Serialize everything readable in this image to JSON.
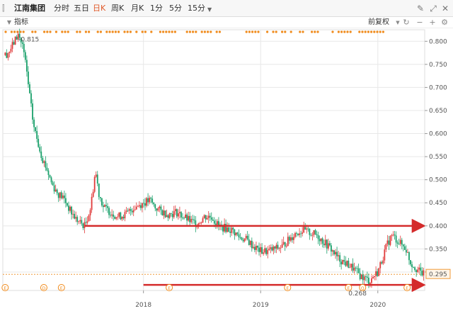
{
  "toolbar": {
    "stock_name": "江南集团",
    "tabs": [
      "分时",
      "五日",
      "日K",
      "周K",
      "月K",
      "1分",
      "5分",
      "15分"
    ],
    "active_tab": "日K",
    "dropdown_caret": "▼",
    "icons": [
      "pencil-icon",
      "fullscreen-icon",
      "close-icon"
    ]
  },
  "subbar": {
    "indicator_label": "指标",
    "adjust_label": "前复权",
    "icons": [
      "refresh-icon",
      "zoom-out-icon",
      "zoom-in-icon",
      "settings-icon"
    ]
  },
  "chart_data": {
    "type": "candlestick",
    "y_ticks": [
      "0.800",
      "0.750",
      "0.700",
      "0.650",
      "0.600",
      "0.550",
      "0.500",
      "0.450",
      "0.400",
      "0.350",
      "0.300"
    ],
    "ylim": [
      0.26,
      0.825
    ],
    "x_ticks": [
      "2018",
      "2019",
      "2020"
    ],
    "x_tick_positions": [
      2018.0,
      2019.0,
      2020.0
    ],
    "xlim": [
      2016.8,
      2020.4
    ],
    "current_price": "0.295",
    "high_annotation": "0.815",
    "low_annotation": "0.268",
    "trend": [
      [
        2016.82,
        0.77
      ],
      [
        2016.86,
        0.78
      ],
      [
        2016.9,
        0.8
      ],
      [
        2016.93,
        0.815
      ],
      [
        2016.97,
        0.79
      ],
      [
        2017.0,
        0.74
      ],
      [
        2017.03,
        0.68
      ],
      [
        2017.06,
        0.62
      ],
      [
        2017.1,
        0.58
      ],
      [
        2017.14,
        0.545
      ],
      [
        2017.18,
        0.52
      ],
      [
        2017.22,
        0.49
      ],
      [
        2017.27,
        0.47
      ],
      [
        2017.32,
        0.46
      ],
      [
        2017.38,
        0.43
      ],
      [
        2017.44,
        0.41
      ],
      [
        2017.5,
        0.4
      ],
      [
        2017.55,
        0.44
      ],
      [
        2017.59,
        0.52
      ],
      [
        2017.62,
        0.47
      ],
      [
        2017.66,
        0.44
      ],
      [
        2017.72,
        0.43
      ],
      [
        2017.78,
        0.42
      ],
      [
        2017.85,
        0.425
      ],
      [
        2017.92,
        0.44
      ],
      [
        2018.0,
        0.45
      ],
      [
        2018.06,
        0.455
      ],
      [
        2018.1,
        0.44
      ],
      [
        2018.16,
        0.43
      ],
      [
        2018.22,
        0.425
      ],
      [
        2018.28,
        0.43
      ],
      [
        2018.34,
        0.42
      ],
      [
        2018.4,
        0.41
      ],
      [
        2018.46,
        0.405
      ],
      [
        2018.52,
        0.42
      ],
      [
        2018.58,
        0.42
      ],
      [
        2018.64,
        0.4
      ],
      [
        2018.7,
        0.395
      ],
      [
        2018.76,
        0.39
      ],
      [
        2018.82,
        0.375
      ],
      [
        2018.88,
        0.37
      ],
      [
        2018.94,
        0.355
      ],
      [
        2019.0,
        0.345
      ],
      [
        2019.06,
        0.345
      ],
      [
        2019.12,
        0.35
      ],
      [
        2019.18,
        0.355
      ],
      [
        2019.24,
        0.37
      ],
      [
        2019.3,
        0.385
      ],
      [
        2019.36,
        0.39
      ],
      [
        2019.42,
        0.385
      ],
      [
        2019.48,
        0.38
      ],
      [
        2019.54,
        0.365
      ],
      [
        2019.6,
        0.35
      ],
      [
        2019.66,
        0.33
      ],
      [
        2019.72,
        0.32
      ],
      [
        2019.78,
        0.31
      ],
      [
        2019.82,
        0.3
      ],
      [
        2019.86,
        0.29
      ],
      [
        2019.9,
        0.285
      ],
      [
        2019.93,
        0.28
      ],
      [
        2019.96,
        0.29
      ],
      [
        2020.0,
        0.3
      ],
      [
        2020.04,
        0.33
      ],
      [
        2020.08,
        0.36
      ],
      [
        2020.12,
        0.38
      ],
      [
        2020.16,
        0.37
      ],
      [
        2020.2,
        0.36
      ],
      [
        2020.24,
        0.35
      ],
      [
        2020.28,
        0.32
      ],
      [
        2020.32,
        0.31
      ],
      [
        2020.36,
        0.3
      ],
      [
        2020.39,
        0.295
      ]
    ],
    "annotation_lines": [
      {
        "x1": 2017.5,
        "x2": 2020.38,
        "y": 0.4,
        "color": "#d42b2b"
      },
      {
        "x1": 2018.0,
        "x2": 2020.38,
        "y": 0.272,
        "color": "#d42b2b"
      }
    ],
    "event_markers": [
      {
        "x": 2016.82,
        "label": "E"
      },
      {
        "x": 2017.15,
        "label": "D"
      },
      {
        "x": 2017.3,
        "label": "E"
      },
      {
        "x": 2018.22,
        "label": "E"
      },
      {
        "x": 2019.23,
        "label": "E"
      },
      {
        "x": 2019.75,
        "label": "E"
      },
      {
        "x": 2019.87,
        "label": "Q"
      },
      {
        "x": 2020.25,
        "label": "E"
      }
    ],
    "colors": {
      "up": "#e03a3a",
      "down": "#1aa06b",
      "price_line": "#f09a3a",
      "grid": "#e8e8e8"
    }
  }
}
